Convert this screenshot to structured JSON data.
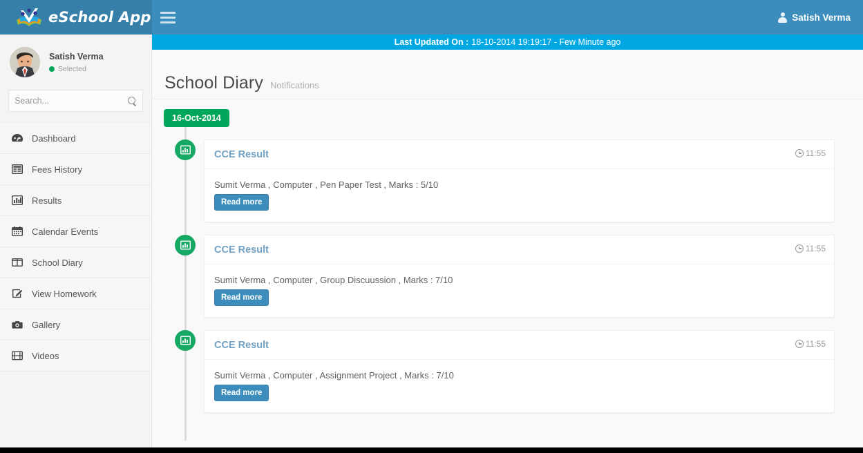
{
  "brand": {
    "name": "eSchool App",
    "logo_icon": "book-people-logo-icon"
  },
  "topbar": {
    "menu_toggle_icon": "hamburger-icon",
    "user_icon": "user-icon",
    "user_name": "Satish Verma"
  },
  "banner": {
    "label": "Last Updated On :",
    "value": "18-10-2014 19:19:17 - Few Minute ago"
  },
  "sidebar": {
    "profile": {
      "name": "Satish Verma",
      "status": "Selected",
      "avatar_icon": "user-avatar"
    },
    "search": {
      "placeholder": "Search...",
      "value": "",
      "icon": "search-icon"
    },
    "items": [
      {
        "label": "Dashboard",
        "icon": "dashboard-icon"
      },
      {
        "label": "Fees History",
        "icon": "table-icon"
      },
      {
        "label": "Results",
        "icon": "bar-chart-icon"
      },
      {
        "label": "Calendar Events",
        "icon": "calendar-icon"
      },
      {
        "label": "School Diary",
        "icon": "columns-icon"
      },
      {
        "label": "View Homework",
        "icon": "pencil-square-icon"
      },
      {
        "label": "Gallery",
        "icon": "camera-icon"
      },
      {
        "label": "Videos",
        "icon": "film-icon"
      }
    ]
  },
  "page": {
    "title": "School Diary",
    "subtitle": "Notifications"
  },
  "timeline": {
    "date_label": "16-Oct-2014",
    "entries": [
      {
        "badge_icon": "bar-chart-icon",
        "title": "CCE Result",
        "time": "11:55",
        "body": "Sumit Verma , Computer , Pen Paper Test , Marks : 5/10",
        "button": "Read more"
      },
      {
        "badge_icon": "bar-chart-icon",
        "title": "CCE Result",
        "time": "11:55",
        "body": "Sumit Verma , Computer , Group Discuussion , Marks : 7/10",
        "button": "Read more"
      },
      {
        "badge_icon": "bar-chart-icon",
        "title": "CCE Result",
        "time": "11:55",
        "body": "Sumit Verma , Computer , Assignment Project , Marks : 7/10",
        "button": "Read more"
      }
    ]
  },
  "colors": {
    "header_blue": "#3c8dbc",
    "logo_blue": "#367fa9",
    "banner_cyan": "#00a7e1",
    "green": "#00a65a",
    "badge_green": "#17a963",
    "card_title": "#72a0c1"
  }
}
